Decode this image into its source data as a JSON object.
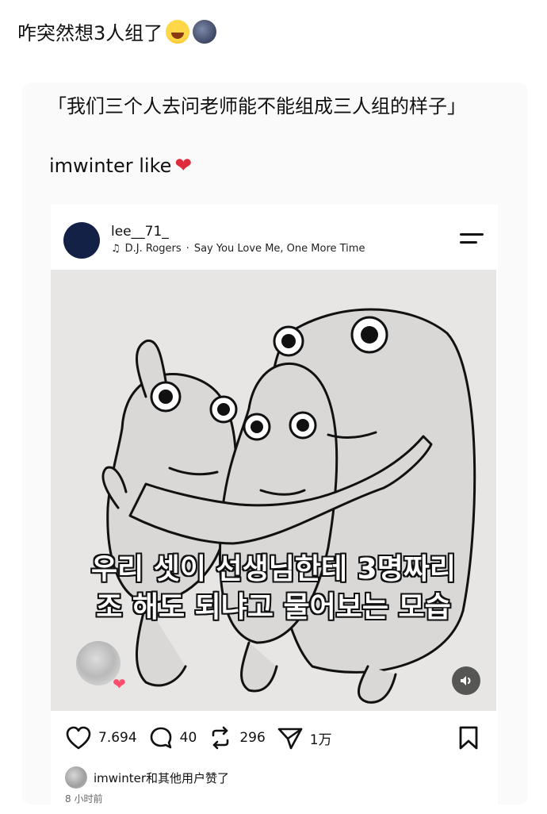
{
  "post": {
    "title": "咋突然想3人组了",
    "emojis": [
      "laughing-tears-icon",
      "new-moon-face-icon"
    ]
  },
  "quote": {
    "text": "「我们三个人去问老师能不能组成三人组的样子」",
    "likes_line": "imwinter like",
    "heart": "❤"
  },
  "instagram": {
    "username": "lee__71_",
    "music": {
      "artist": "D.J. Rogers",
      "separator": "·",
      "song": "Say You Love Me, One More Time"
    },
    "caption_lines": [
      "우리 셋이 선생님한테 3명짜리",
      "조 해도 되냐고 물어보는 모습"
    ],
    "counts": {
      "likes": "7.694",
      "comments": "40",
      "reposts": "296",
      "shares": "1万"
    },
    "liked_by": "imwinter和其他用户赞了",
    "timestamp": "8 小时前",
    "colors": {
      "avatar": "#142147",
      "heart_red": "#e02b3c",
      "text": "#111111"
    }
  }
}
